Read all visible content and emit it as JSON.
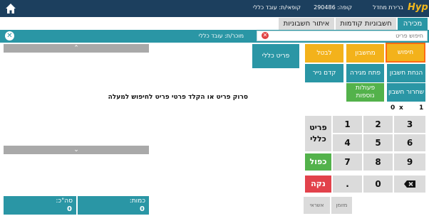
{
  "header": {
    "logo_text": "Hyp",
    "terminal_label": "קופה: 290486",
    "seller_label": "קופאי/ת: עובד כללי",
    "company_label": "ברירת מחדל"
  },
  "tabs": [
    {
      "label": "מכירה"
    },
    {
      "label": "חשבוניות קודמות"
    },
    {
      "label": "איתור חשבוניות"
    }
  ],
  "search": {
    "placeholder": "חיפוש פריט",
    "seller_text": "מוכר/ת: עובד כללי"
  },
  "list": {
    "empty_message": "סרוק פריט או הקלד פרטי פריט לחיפוש למעלה",
    "scroll_up": "⌃",
    "scroll_down": "⌄"
  },
  "totals": {
    "quantity_label": "כמות:",
    "quantity_value": "0",
    "sum_label": "סה\"כ:",
    "sum_value": "0"
  },
  "general_item": "פריט כללי",
  "functions": {
    "search": "חיפוש",
    "calculator": "מחשבון",
    "cancel": "לבטל",
    "invoice_discount": "הנחת חשבון",
    "open_drawer": "פתח מגירה",
    "paper_code": "קדם נייר",
    "release_invoice": "שחרור חשבון",
    "more_actions": "פעולות נוספות"
  },
  "display": {
    "qty": "1",
    "times": "x",
    "price": "0"
  },
  "keypad": {
    "k1": "1",
    "k2": "2",
    "k3": "3",
    "k4": "4",
    "k5": "5",
    "k6": "6",
    "k7": "7",
    "k8": "8",
    "k9": "9",
    "k0": "0",
    "kdot": ".",
    "general_line1": "פריט",
    "general_line2": "כללי",
    "double": "כפול",
    "clear": "נקה"
  },
  "payments": {
    "credit": "אשראי",
    "cash": "מזומן"
  },
  "colors": {
    "header_bg": "#1c3f5e",
    "accent": "#2a96a5",
    "orange": "#f3b21b",
    "green": "#53b24b",
    "red": "#e2424b"
  }
}
